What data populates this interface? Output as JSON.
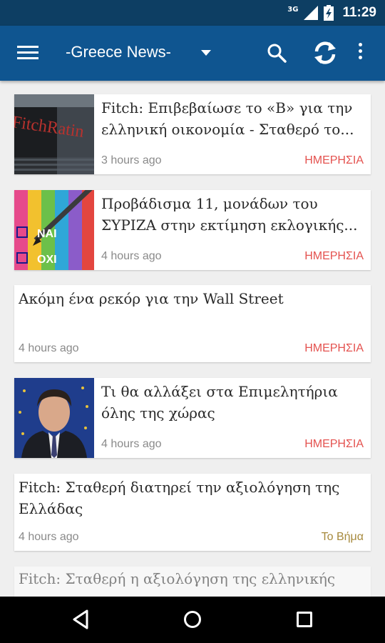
{
  "status_bar": {
    "network_label": "3G",
    "time": "11:29"
  },
  "app_bar": {
    "title": "-Greece News-"
  },
  "colors": {
    "app_bar": "#0f5590",
    "status_bar": "#0d3e63",
    "source_imerisia": "#e4524f",
    "source_tovima": "#a78a3d"
  },
  "articles": [
    {
      "title": "Fitch: Επιβεβαίωσε το «Β» για την ελληνική οικονομία - Σταθερό το...",
      "time": "3 hours ago",
      "source": "ΗΜΕΡΗΣΙΑ",
      "image": "fitch-ratings-building",
      "thumb_caption": "FitchRatin"
    },
    {
      "title": "Προβάδισμα 11, μονάδων του ΣΥΡΙΖΑ στην εκτίμηση εκλογικής...",
      "time": "4 hours ago",
      "source": "ΗΜΕΡΗΣΙΑ",
      "image": "ballot-nai-oxi",
      "thumb_yes": "ΝΑΙ",
      "thumb_no": "ΟΧΙ"
    },
    {
      "title": "Ακόμη ένα ρεκόρ για την Wall Street",
      "time": "4 hours ago",
      "source": "ΗΜΕΡΗΣΙΑ"
    },
    {
      "title": "Τι θα αλλάξει στα Επιμελητήρια όλης της χώρας",
      "time": "4 hours ago",
      "source": "ΗΜΕΡΗΣΙΑ",
      "image": "politician-portrait"
    },
    {
      "title": "Fitch: Σταθερή διατηρεί την αξιολόγηση της Ελλάδας",
      "time": "4 hours ago",
      "source": "Το Βήμα"
    },
    {
      "title": "Fitch: Σταθερή η αξιολόγηση της ελληνικής"
    }
  ]
}
